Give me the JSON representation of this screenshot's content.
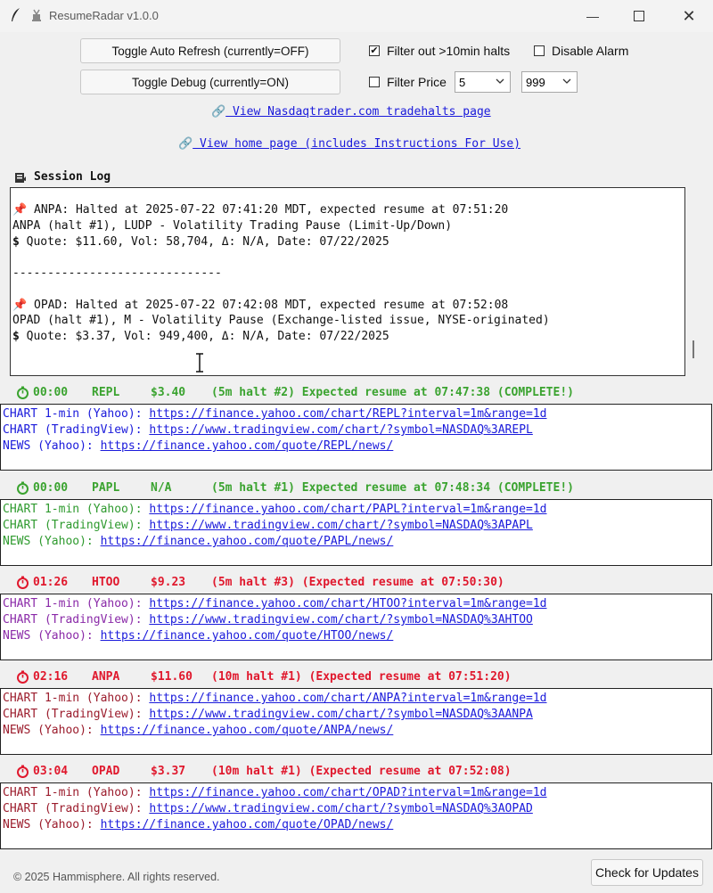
{
  "window": {
    "title": "ResumeRadar v1.0.0"
  },
  "controls": {
    "auto_refresh_label": "Toggle Auto Refresh (currently=OFF)",
    "debug_label": "Toggle Debug (currently=ON)",
    "filter_halts_label": "Filter out >10min halts",
    "filter_halts_checked": true,
    "disable_alarm_label": "Disable Alarm",
    "disable_alarm_checked": false,
    "filter_price_label": "Filter Price",
    "filter_price_checked": false,
    "price_min": "5",
    "price_max": "999"
  },
  "links": {
    "nasdaq": "View Nasdaqtrader.com tradehalts page",
    "home": "View home page (includes Instructions For Use)"
  },
  "session_log": {
    "label": "Session Log",
    "lines": [
      "ANPA: Halted at 2025-07-22 07:41:20 MDT, expected resume at 07:51:20",
      "ANPA (halt #1), LUDP - Volatility Trading Pause (Limit-Up/Down)",
      "Quote: $11.60, Vol: 58,704, Δ: N/A, Date: 07/22/2025",
      "------------------------------",
      "OPAD: Halted at 2025-07-22 07:42:08 MDT, expected resume at 07:52:08",
      "OPAD (halt #1), M - Volatility Pause (Exchange-listed issue, NYSE-originated)",
      "Quote: $3.37, Vol: 949,400, Δ: N/A, Date: 07/22/2025"
    ]
  },
  "halts": [
    {
      "timer": "00:00",
      "symbol": "REPL",
      "price": "$3.40",
      "status": "(5m halt #2) Expected resume at 07:47:38 (COMPLETE!)",
      "color": "#3aa32f",
      "text_color": "#1a1adb",
      "chart1_label": "CHART 1-min (Yahoo): ",
      "chart1_url": "https://finance.yahoo.com/chart/REPL?interval=1m&range=1d",
      "chart2_label": "CHART (TradingView): ",
      "chart2_url": "https://www.tradingview.com/chart/?symbol=NASDAQ%3AREPL",
      "news_label": "NEWS (Yahoo): ",
      "news_url": "https://finance.yahoo.com/quote/REPL/news/"
    },
    {
      "timer": "00:00",
      "symbol": "PAPL",
      "price": "N/A",
      "status": "(5m halt #1) Expected resume at 07:48:34 (COMPLETE!)",
      "color": "#3aa32f",
      "text_color": "#2e9a2e",
      "chart1_label": "CHART 1-min (Yahoo): ",
      "chart1_url": "https://finance.yahoo.com/chart/PAPL?interval=1m&range=1d",
      "chart2_label": "CHART (TradingView): ",
      "chart2_url": "https://www.tradingview.com/chart/?symbol=NASDAQ%3APAPL",
      "news_label": "NEWS (Yahoo): ",
      "news_url": "https://finance.yahoo.com/quote/PAPL/news/"
    },
    {
      "timer": "01:26",
      "symbol": "HTOO",
      "price": "$9.23",
      "status": "(5m halt #3) (Expected resume at 07:50:30)",
      "color": "#e0182d",
      "text_color": "#8a2aa8",
      "chart1_label": "CHART 1-min (Yahoo): ",
      "chart1_url": "https://finance.yahoo.com/chart/HTOO?interval=1m&range=1d",
      "chart2_label": "CHART (TradingView): ",
      "chart2_url": "https://www.tradingview.com/chart/?symbol=NASDAQ%3AHTOO",
      "news_label": "NEWS (Yahoo): ",
      "news_url": "https://finance.yahoo.com/quote/HTOO/news/"
    },
    {
      "timer": "02:16",
      "symbol": "ANPA",
      "price": "$11.60",
      "status": "(10m halt #1) (Expected resume at 07:51:20)",
      "color": "#e0182d",
      "text_color": "#9b1c2c",
      "chart1_label": "CHART 1-min (Yahoo): ",
      "chart1_url": "https://finance.yahoo.com/chart/ANPA?interval=1m&range=1d",
      "chart2_label": "CHART (TradingView): ",
      "chart2_url": "https://www.tradingview.com/chart/?symbol=NASDAQ%3AANPA",
      "news_label": "NEWS (Yahoo): ",
      "news_url": "https://finance.yahoo.com/quote/ANPA/news/"
    },
    {
      "timer": "03:04",
      "symbol": "OPAD",
      "price": "$3.37",
      "status": "(10m halt #1) (Expected resume at 07:52:08)",
      "color": "#e0182d",
      "text_color": "#9b1c2c",
      "chart1_label": "CHART 1-min (Yahoo): ",
      "chart1_url": "https://finance.yahoo.com/chart/OPAD?interval=1m&range=1d",
      "chart2_label": "CHART (TradingView): ",
      "chart2_url": "https://www.tradingview.com/chart/?symbol=NASDAQ%3AOPAD",
      "news_label": "NEWS (Yahoo): ",
      "news_url": "https://finance.yahoo.com/quote/OPAD/news/"
    }
  ],
  "footer": {
    "copyright": "© 2025 Hammisphere. All rights reserved.",
    "update_button": "Check for Updates"
  }
}
